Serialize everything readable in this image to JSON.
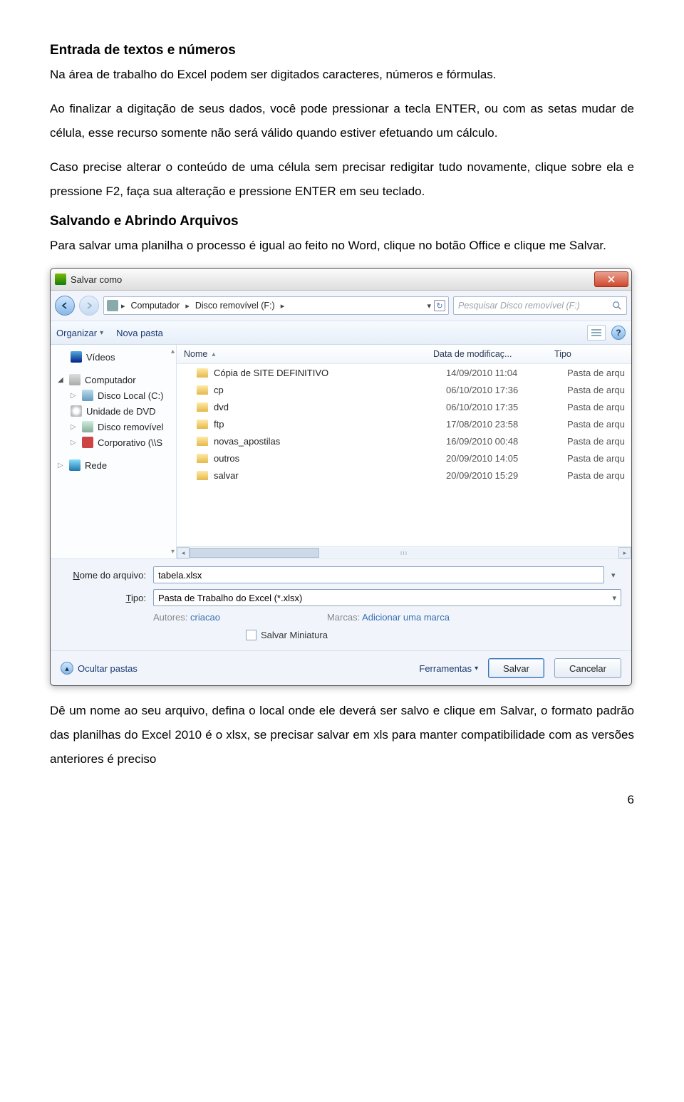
{
  "headings": {
    "h1": "Entrada de textos e números",
    "h2": "Salvando e Abrindo Arquivos"
  },
  "paragraphs": {
    "p1": "Na área de trabalho do Excel podem ser digitados caracteres, números e fórmulas.",
    "p2": "Ao finalizar a digitação de seus dados, você pode pressionar a tecla ENTER, ou com as setas mudar de célula, esse recurso somente não será válido quando estiver efetuando um cálculo.",
    "p3": "Caso precise alterar o conteúdo de uma célula sem precisar redigitar tudo novamente, clique sobre ela e pressione F2, faça sua alteração e pressione ENTER em seu teclado.",
    "p4": "Para salvar uma planilha o processo é igual ao feito no Word, clique no botão Office e clique me Salvar.",
    "p5": "Dê um nome ao seu arquivo, defina o local onde ele deverá ser salvo e clique em Salvar, o formato padrão das planilhas do Excel 2010 é o xlsx, se precisar salvar em xls para manter compatibilidade com as versões anteriores é preciso"
  },
  "pageNumber": "6",
  "dialog": {
    "title": "Salvar como",
    "breadcrumb": {
      "root": "Computador",
      "drive": "Disco removível (F:)"
    },
    "searchPlaceholder": "Pesquisar Disco removível (F:)",
    "toolbar": {
      "organize": "Organizar",
      "newFolder": "Nova pasta"
    },
    "nav": {
      "videos": "Vídeos",
      "computer": "Computador",
      "localDisk": "Disco Local (C:)",
      "dvd": "Unidade de DVD",
      "removable": "Disco removível",
      "corporate": "Corporativo (\\\\S",
      "network": "Rede"
    },
    "columns": {
      "name": "Nome",
      "date": "Data de modificaç...",
      "type": "Tipo"
    },
    "files": [
      {
        "name": "Cópia de SITE DEFINITIVO",
        "date": "14/09/2010 11:04",
        "type": "Pasta de arqu"
      },
      {
        "name": "cp",
        "date": "06/10/2010 17:36",
        "type": "Pasta de arqu"
      },
      {
        "name": "dvd",
        "date": "06/10/2010 17:35",
        "type": "Pasta de arqu"
      },
      {
        "name": "ftp",
        "date": "17/08/2010 23:58",
        "type": "Pasta de arqu"
      },
      {
        "name": "novas_apostilas",
        "date": "16/09/2010 00:48",
        "type": "Pasta de arqu"
      },
      {
        "name": "outros",
        "date": "20/09/2010 14:05",
        "type": "Pasta de arqu"
      },
      {
        "name": "salvar",
        "date": "20/09/2010 15:29",
        "type": "Pasta de arqu"
      }
    ],
    "form": {
      "filenameLabel": "Nome do arquivo:",
      "filenameValue": "tabela.xlsx",
      "typeLabel": "Tipo:",
      "typeValue": "Pasta de Trabalho do Excel (*.xlsx)",
      "authorsLabel": "Autores:",
      "authorsValue": "criacao",
      "tagsLabel": "Marcas:",
      "tagsValue": "Adicionar uma marca",
      "thumbnail": "Salvar Miniatura"
    },
    "bottom": {
      "hideFolders": "Ocultar pastas",
      "tools": "Ferramentas",
      "save": "Salvar",
      "cancel": "Cancelar"
    }
  }
}
